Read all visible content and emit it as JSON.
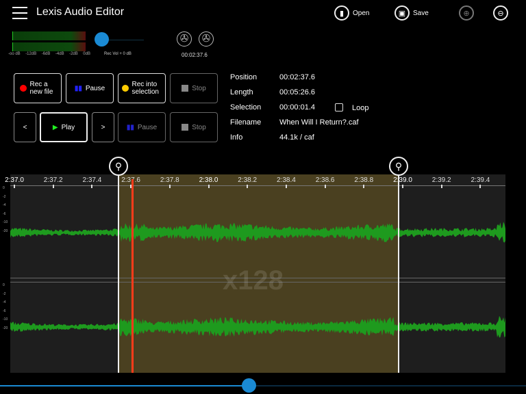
{
  "header": {
    "title": "Lexis Audio Editor",
    "open_label": "Open",
    "save_label": "Save"
  },
  "meter": {
    "scale": [
      "-oo dB",
      "-12dB",
      "-6dB",
      "-4dB",
      "-2dB",
      "0dB"
    ],
    "rec_vol_label": "Rec Vol + 0 dB",
    "rec_vol_level": 0.05,
    "time": "00:02:37.6"
  },
  "controls": {
    "rec_new": "Rec a new file",
    "pause": "Pause",
    "rec_into": "Rec into selection",
    "stop": "Stop",
    "prev": "<",
    "play": "Play",
    "next": ">",
    "pause2": "Pause",
    "stop2": "Stop"
  },
  "info": {
    "position_label": "Position",
    "position": "00:02:37.6",
    "length_label": "Length",
    "length": "00:05:26.6",
    "selection_label": "Selection",
    "selection": "00:00:01.4",
    "loop_label": "Loop",
    "loop_checked": false,
    "filename_label": "Filename",
    "filename": "When Will I Return?.caf",
    "info_label": "Info",
    "info": "44.1k / caf"
  },
  "ruler": {
    "ticks": [
      "2:37.0",
      "2:37.2",
      "2:37.4",
      "2:37.6",
      "2:37.8",
      "2:38.0",
      "2:38.2",
      "2:38.4",
      "2:38.6",
      "2:38.8",
      "2:39.0",
      "2:39.2",
      "2:39.4"
    ]
  },
  "y_axis": [
    "0",
    "-2",
    "-4",
    "-6",
    "-10",
    "-20"
  ],
  "zoom_label": "x128",
  "scroll_position": 0.47,
  "colors": {
    "wave": "#1e9a1e",
    "selection": "#4a4020",
    "playhead": "#ff3b1a",
    "accent": "#1a8ad4"
  }
}
